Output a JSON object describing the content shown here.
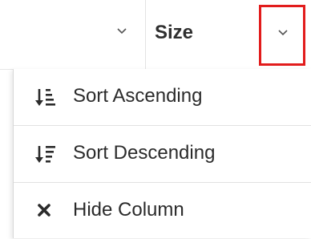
{
  "header": {
    "column_title": "Size",
    "icons": {
      "previous_column_chevron": "chevron-down-icon",
      "menu_chevron": "chevron-down-icon"
    },
    "highlight_color": "#e21c1c"
  },
  "menu": {
    "items": [
      {
        "label": "Sort Ascending",
        "icon": "sort-ascending-icon"
      },
      {
        "label": "Sort Descending",
        "icon": "sort-descending-icon"
      },
      {
        "label": "Hide Column",
        "icon": "close-icon"
      }
    ]
  }
}
